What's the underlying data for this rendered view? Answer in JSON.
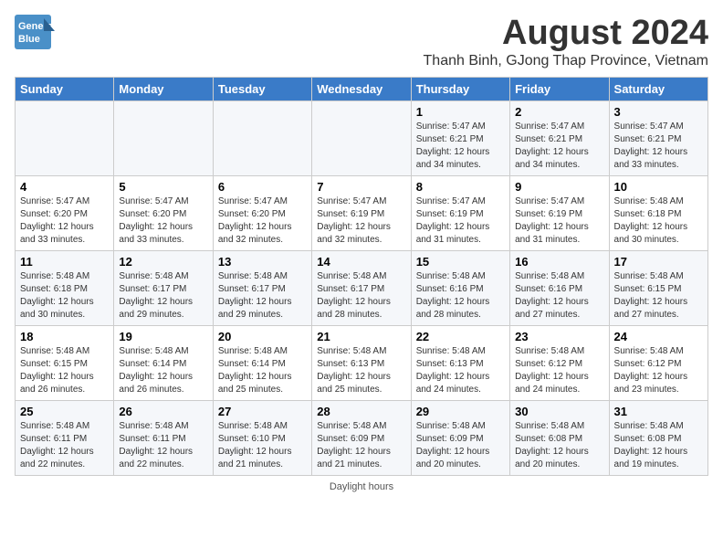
{
  "header": {
    "logo_line1": "General",
    "logo_line2": "Blue",
    "month_title": "August 2024",
    "location": "Thanh Binh, GJong Thap Province, Vietnam"
  },
  "days_of_week": [
    "Sunday",
    "Monday",
    "Tuesday",
    "Wednesday",
    "Thursday",
    "Friday",
    "Saturday"
  ],
  "weeks": [
    [
      {
        "day": "",
        "info": ""
      },
      {
        "day": "",
        "info": ""
      },
      {
        "day": "",
        "info": ""
      },
      {
        "day": "",
        "info": ""
      },
      {
        "day": "1",
        "info": "Sunrise: 5:47 AM\nSunset: 6:21 PM\nDaylight: 12 hours\nand 34 minutes."
      },
      {
        "day": "2",
        "info": "Sunrise: 5:47 AM\nSunset: 6:21 PM\nDaylight: 12 hours\nand 34 minutes."
      },
      {
        "day": "3",
        "info": "Sunrise: 5:47 AM\nSunset: 6:21 PM\nDaylight: 12 hours\nand 33 minutes."
      }
    ],
    [
      {
        "day": "4",
        "info": "Sunrise: 5:47 AM\nSunset: 6:20 PM\nDaylight: 12 hours\nand 33 minutes."
      },
      {
        "day": "5",
        "info": "Sunrise: 5:47 AM\nSunset: 6:20 PM\nDaylight: 12 hours\nand 33 minutes."
      },
      {
        "day": "6",
        "info": "Sunrise: 5:47 AM\nSunset: 6:20 PM\nDaylight: 12 hours\nand 32 minutes."
      },
      {
        "day": "7",
        "info": "Sunrise: 5:47 AM\nSunset: 6:19 PM\nDaylight: 12 hours\nand 32 minutes."
      },
      {
        "day": "8",
        "info": "Sunrise: 5:47 AM\nSunset: 6:19 PM\nDaylight: 12 hours\nand 31 minutes."
      },
      {
        "day": "9",
        "info": "Sunrise: 5:47 AM\nSunset: 6:19 PM\nDaylight: 12 hours\nand 31 minutes."
      },
      {
        "day": "10",
        "info": "Sunrise: 5:48 AM\nSunset: 6:18 PM\nDaylight: 12 hours\nand 30 minutes."
      }
    ],
    [
      {
        "day": "11",
        "info": "Sunrise: 5:48 AM\nSunset: 6:18 PM\nDaylight: 12 hours\nand 30 minutes."
      },
      {
        "day": "12",
        "info": "Sunrise: 5:48 AM\nSunset: 6:17 PM\nDaylight: 12 hours\nand 29 minutes."
      },
      {
        "day": "13",
        "info": "Sunrise: 5:48 AM\nSunset: 6:17 PM\nDaylight: 12 hours\nand 29 minutes."
      },
      {
        "day": "14",
        "info": "Sunrise: 5:48 AM\nSunset: 6:17 PM\nDaylight: 12 hours\nand 28 minutes."
      },
      {
        "day": "15",
        "info": "Sunrise: 5:48 AM\nSunset: 6:16 PM\nDaylight: 12 hours\nand 28 minutes."
      },
      {
        "day": "16",
        "info": "Sunrise: 5:48 AM\nSunset: 6:16 PM\nDaylight: 12 hours\nand 27 minutes."
      },
      {
        "day": "17",
        "info": "Sunrise: 5:48 AM\nSunset: 6:15 PM\nDaylight: 12 hours\nand 27 minutes."
      }
    ],
    [
      {
        "day": "18",
        "info": "Sunrise: 5:48 AM\nSunset: 6:15 PM\nDaylight: 12 hours\nand 26 minutes."
      },
      {
        "day": "19",
        "info": "Sunrise: 5:48 AM\nSunset: 6:14 PM\nDaylight: 12 hours\nand 26 minutes."
      },
      {
        "day": "20",
        "info": "Sunrise: 5:48 AM\nSunset: 6:14 PM\nDaylight: 12 hours\nand 25 minutes."
      },
      {
        "day": "21",
        "info": "Sunrise: 5:48 AM\nSunset: 6:13 PM\nDaylight: 12 hours\nand 25 minutes."
      },
      {
        "day": "22",
        "info": "Sunrise: 5:48 AM\nSunset: 6:13 PM\nDaylight: 12 hours\nand 24 minutes."
      },
      {
        "day": "23",
        "info": "Sunrise: 5:48 AM\nSunset: 6:12 PM\nDaylight: 12 hours\nand 24 minutes."
      },
      {
        "day": "24",
        "info": "Sunrise: 5:48 AM\nSunset: 6:12 PM\nDaylight: 12 hours\nand 23 minutes."
      }
    ],
    [
      {
        "day": "25",
        "info": "Sunrise: 5:48 AM\nSunset: 6:11 PM\nDaylight: 12 hours\nand 22 minutes."
      },
      {
        "day": "26",
        "info": "Sunrise: 5:48 AM\nSunset: 6:11 PM\nDaylight: 12 hours\nand 22 minutes."
      },
      {
        "day": "27",
        "info": "Sunrise: 5:48 AM\nSunset: 6:10 PM\nDaylight: 12 hours\nand 21 minutes."
      },
      {
        "day": "28",
        "info": "Sunrise: 5:48 AM\nSunset: 6:09 PM\nDaylight: 12 hours\nand 21 minutes."
      },
      {
        "day": "29",
        "info": "Sunrise: 5:48 AM\nSunset: 6:09 PM\nDaylight: 12 hours\nand 20 minutes."
      },
      {
        "day": "30",
        "info": "Sunrise: 5:48 AM\nSunset: 6:08 PM\nDaylight: 12 hours\nand 20 minutes."
      },
      {
        "day": "31",
        "info": "Sunrise: 5:48 AM\nSunset: 6:08 PM\nDaylight: 12 hours\nand 19 minutes."
      }
    ]
  ],
  "footer": {
    "text": "Daylight hours"
  }
}
